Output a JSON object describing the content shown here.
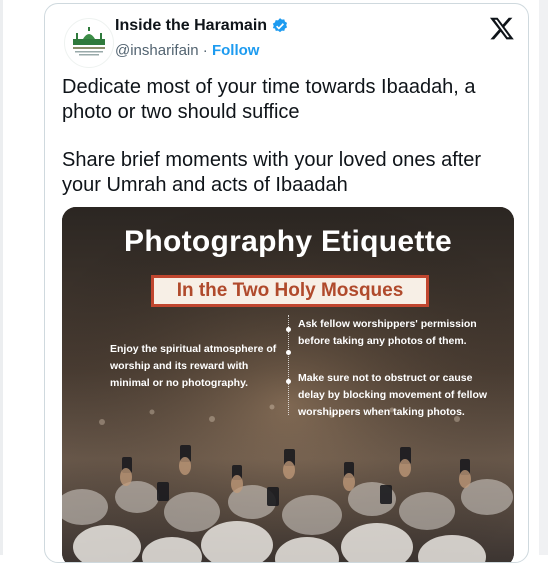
{
  "tweet": {
    "account_name": "Inside the Haramain",
    "handle": "@insharifain",
    "separator": "·",
    "follow_label": "Follow",
    "platform_icon": "x-logo-icon",
    "text": [
      "Dedicate most of your time towards Ibaadah, a photo or two should suffice",
      "Share brief moments with your loved ones after your Umrah and acts of Ibaadah"
    ]
  },
  "infographic": {
    "title": "Photography Etiquette",
    "subtitle": "In the Two Holy Mosques",
    "tip_left": "Enjoy the spiritual atmosphere of worship and its reward with minimal or no photography.",
    "tip_right_1": "Ask fellow worshippers' permission before taking any photos of them.",
    "tip_right_2": "Make sure not to obstruct or cause delay by blocking movement of fellow worshippers when taking photos."
  },
  "colors": {
    "verified": "#1d9bf0",
    "link": "#1d9bf0",
    "subtitle_border": "#c0462f",
    "subtitle_text": "#b04a2c"
  }
}
